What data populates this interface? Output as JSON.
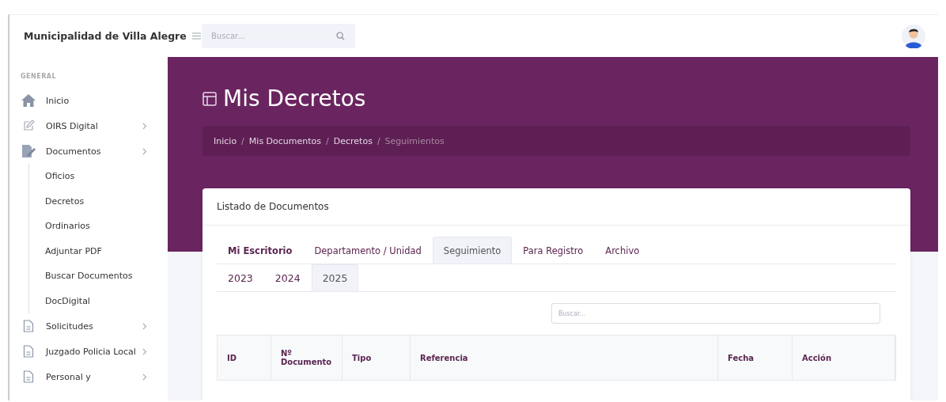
{
  "topbar": {
    "brand": "Municipalidad de Villa Alegre",
    "search": {
      "placeholder": "Buscar..."
    }
  },
  "sidebar": {
    "section": "GENERAL",
    "items": [
      {
        "label": "Inicio",
        "has_arrow": false
      },
      {
        "label": "OIRS Digital",
        "has_arrow": true
      },
      {
        "label": "Documentos",
        "has_arrow": true,
        "children": [
          {
            "label": "Oficios"
          },
          {
            "label": "Decretos"
          },
          {
            "label": "Ordinarios"
          },
          {
            "label": "Adjuntar PDF"
          },
          {
            "label": "Buscar Documentos"
          },
          {
            "label": "DocDigital"
          }
        ]
      },
      {
        "label": "Solicitudes",
        "has_arrow": true
      },
      {
        "label": "Juzgado Policia Local",
        "has_arrow": true
      },
      {
        "label": "Personal y",
        "has_arrow": true
      }
    ]
  },
  "page": {
    "title": "Mis Decretos",
    "breadcrumb_separator": "/",
    "breadcrumb": [
      {
        "label": "Inicio",
        "current": false
      },
      {
        "label": "Mis Documentos",
        "current": false
      },
      {
        "label": "Decretos",
        "current": false
      },
      {
        "label": "Seguimientos",
        "current": true
      }
    ]
  },
  "card": {
    "title": "Listado de Documentos",
    "tabs": [
      {
        "label": "Mi Escritorio",
        "selected": false,
        "bold": true
      },
      {
        "label": "Departamento / Unidad",
        "selected": false,
        "bold": false
      },
      {
        "label": "Seguimiento",
        "selected": true,
        "bold": false
      },
      {
        "label": "Para Registro",
        "selected": false,
        "bold": false
      },
      {
        "label": "Archivo",
        "selected": false,
        "bold": false
      }
    ],
    "year_tabs": [
      {
        "label": "2023",
        "selected": false
      },
      {
        "label": "2024",
        "selected": false
      },
      {
        "label": "2025",
        "selected": true
      }
    ],
    "search": {
      "placeholder": "Buscar..."
    },
    "table": {
      "columns": [
        "ID",
        "Nº Documento",
        "Tipo",
        "Referencia",
        "Fecha",
        "Acción"
      ]
    }
  }
}
